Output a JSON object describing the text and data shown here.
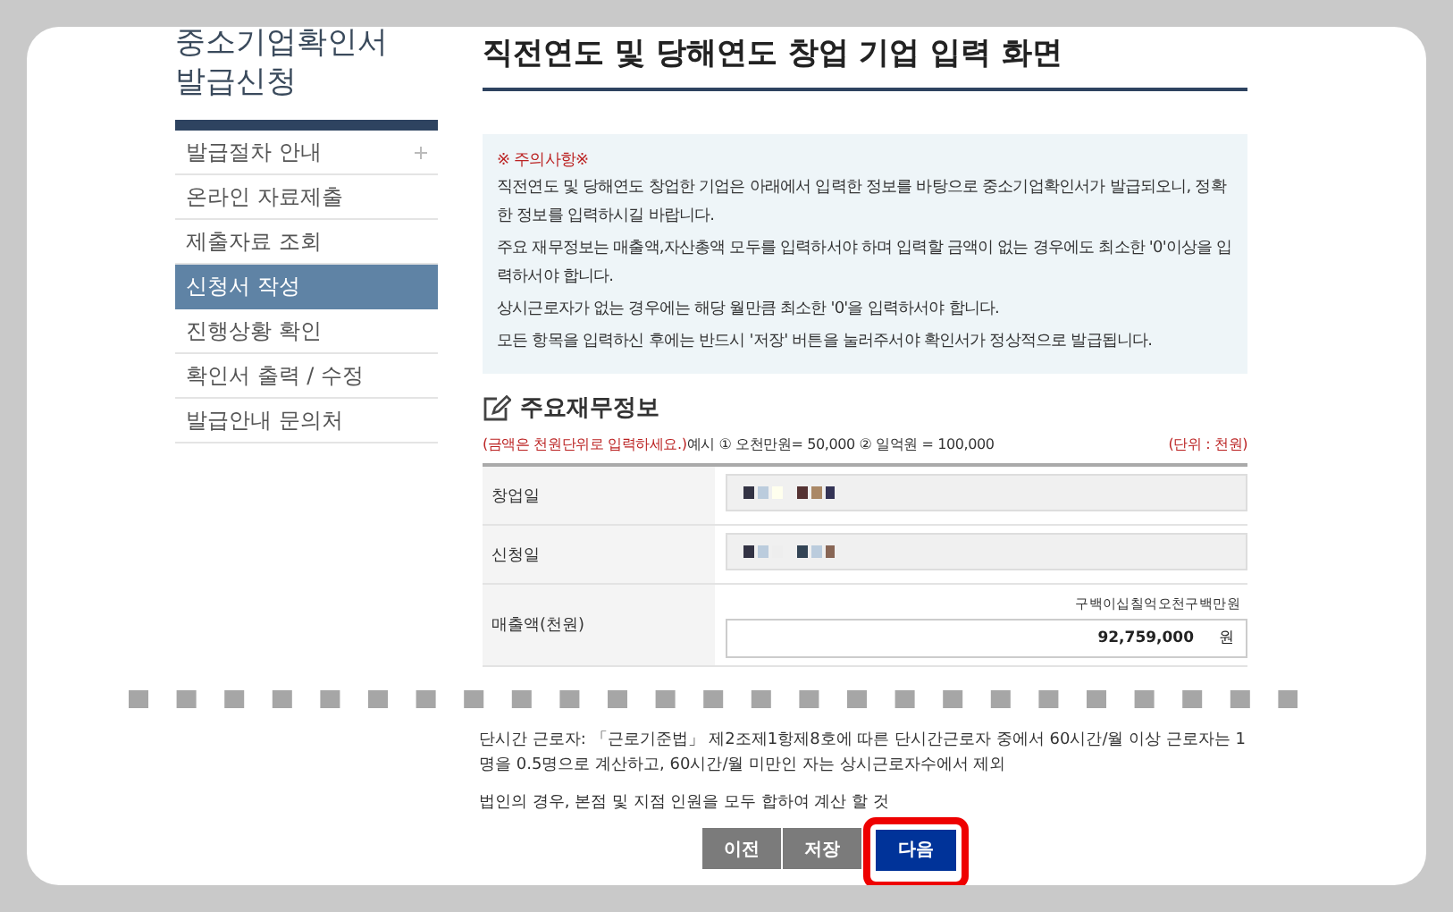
{
  "sidebar": {
    "title_lines": [
      "중소기업확인서",
      "발급신청"
    ],
    "items": [
      {
        "label": "발급절차 안내",
        "selected": false,
        "expandable": true
      },
      {
        "label": "온라인 자료제출",
        "selected": false,
        "expandable": false
      },
      {
        "label": "제출자료 조회",
        "selected": false,
        "expandable": false
      },
      {
        "label": "신청서 작성",
        "selected": true,
        "expandable": false
      },
      {
        "label": "진행상황 확인",
        "selected": false,
        "expandable": false
      },
      {
        "label": "확인서 출력 / 수정",
        "selected": false,
        "expandable": false
      },
      {
        "label": "발급안내 문의처",
        "selected": false,
        "expandable": false
      }
    ]
  },
  "main": {
    "title": "직전연도 및 당해연도 창업 기업 입력 화면",
    "notice": {
      "heading": "※ 주의사항※",
      "paragraphs": [
        "직전연도 및 당해연도 창업한 기업은 아래에서 입력한 정보를 바탕으로 중소기업확인서가 발급되오니, 정확한 정보를 입력하시길 바랍니다.",
        "주요 재무정보는 매출액,자산총액 모두를 입력하서야 하며 입력할 금액이 없는 경우에도 최소한 '0'이상을 입력하서야 합니다.",
        "상시근로자가 없는 경우에는 해당 월만큼 최소한 '0'을 입력하서야 합니다.",
        "모든 항목을 입력하신 후에는 반드시 '저장' 버튼을 눌러주서야 확인서가 정상적으로 발급됩니다."
      ]
    },
    "section_title": "주요재무정보",
    "note": {
      "highlight": "(금액은 천원단위로 입력하세요.)",
      "example": "예시 ① 오천만원= 50,000 ② 일억원 = 100,000",
      "unit": "(단위 : 천원)"
    },
    "form_rows": [
      {
        "label": "창업일",
        "kind": "date"
      },
      {
        "label": "신청일",
        "kind": "date"
      },
      {
        "label": "매출액(천원)",
        "kind": "amount",
        "hint": "구백이십칠억오천구백만원",
        "value": "92,759,000",
        "unit": "원"
      }
    ]
  },
  "footnotes": [
    "단시간 근로자: 「근로기준법」 제2조제1항제8호에 따른 단시간근로자 중에서 60시간/월 이상 근로자는 1명을 0.5명으로 계산하고, 60시간/월 미만인 자는 상시근로자수에서 제외",
    "법인의 경우, 본점 및 지점 인원을 모두 합하여 계산 할 것"
  ],
  "buttons": [
    {
      "label": "이전",
      "kind": "secondary",
      "highlighted": false
    },
    {
      "label": "저장",
      "kind": "secondary",
      "highlighted": false
    },
    {
      "label": "다음",
      "kind": "primary",
      "highlighted": true
    }
  ]
}
